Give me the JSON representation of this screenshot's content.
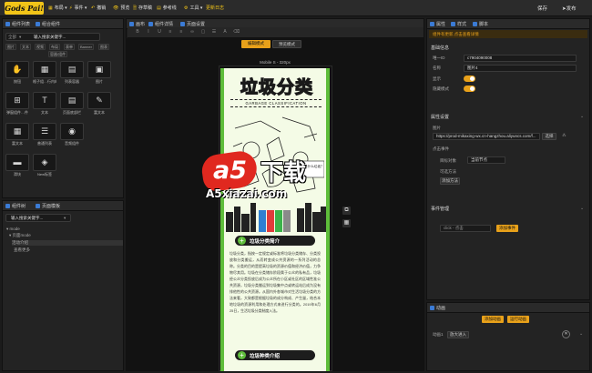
{
  "topbar": {
    "logo": "Gods Pai!",
    "menu": [
      {
        "label": "布局",
        "icon": "▦"
      },
      {
        "label": "事件",
        "icon": "⚡"
      },
      {
        "label": "撤销",
        "icon": "↶"
      },
      {
        "label": "预览",
        "icon": "👁"
      },
      {
        "label": "存草稿",
        "icon": "🗎"
      },
      {
        "label": "参考线",
        "icon": "▤"
      },
      {
        "label": "工具",
        "icon": "⚙"
      },
      {
        "label": "更新日志",
        "icon": ""
      }
    ],
    "save": "保存",
    "publish": "发布"
  },
  "left_panel": {
    "tabs": [
      "组件列表",
      "组合组件"
    ],
    "search_select": "全部",
    "search_value": "输入搜索关键字...",
    "filter_chips": [
      "图片",
      "文本",
      "视频",
      "布局",
      "表单",
      "Banner",
      "图表",
      "容器/组件"
    ],
    "components": [
      {
        "icon": "✋",
        "label": "按钮"
      },
      {
        "icon": "▦",
        "label": "格子组…行内的"
      },
      {
        "icon": "▤",
        "label": "列表容器"
      },
      {
        "icon": "▣",
        "label": "图片"
      },
      {
        "icon": "⊞",
        "label": "弹窗组件…件"
      },
      {
        "icon": "T",
        "label": "文本"
      },
      {
        "icon": "▤",
        "label": "页面底部栏"
      },
      {
        "icon": "✎",
        "label": "富文本"
      },
      {
        "icon": "▦",
        "label": "富文本"
      },
      {
        "icon": "☰",
        "label": "普通列表"
      },
      {
        "icon": "◉",
        "label": "音频组件"
      },
      {
        "icon": "▬",
        "label": "滑块"
      },
      {
        "icon": "◈",
        "label": "New标签"
      }
    ]
  },
  "left_panel2": {
    "tabs": [
      "组件树",
      "页面模板"
    ],
    "search_value": "输入搜索关键字...",
    "tree": [
      "mode",
      "页面mode",
      "活动介绍",
      "查看更多"
    ]
  },
  "center": {
    "tabs": [
      "画布",
      "组件详情",
      "页面设置"
    ],
    "mode_edit": "编辑模式",
    "mode_preview": "预览模式",
    "device_label": "Mobile S - 320px",
    "phone": {
      "title": "垃圾分类",
      "subtitle": "GARBAGE CLASSIFICATION",
      "bubble": "你是什么垃圾？",
      "section1": "垃圾分类简介",
      "body": "垃圾分类，指按一定规定或标准将垃圾分类储存、分类投放和分类搬运，从而转变成公共资源的一系列活动的总称。分类的目的是提高垃圾的资源价值和经济价值，力争物尽其用。垃圾在分类储存阶段属于公众的私有品，垃圾经公众分类投放后成为公众所在小区或社区的区域性准公共资源，垃圾分类搬运到垃圾集中点或转运站后成为没有排他性的公共资源。从国内外各城市对生活垃圾分类的方法来看，大致都是根据垃圾的成分构成、产生量，结合本地垃圾的资源利用和处理方式来进行分类的。2019年6月25日，生活垃圾分类制度入法。",
      "section2": "垃圾种类介绍"
    }
  },
  "right_panel": {
    "tabs": [
      "属性",
      "样式",
      "脚本"
    ],
    "notice": "组件有更新,点击查看详情",
    "basic_title": "基础信息",
    "fields": [
      {
        "label": "唯一ID",
        "value": "c7904090008"
      },
      {
        "label": "名称",
        "value": "图片4"
      }
    ],
    "toggles": [
      "显示",
      "隐藏模式"
    ],
    "attr_title": "属性设置",
    "image_label": "图片",
    "image_url": "https://prod-mikaxing-wx.cn-hangzhou.aliyuncs.com/f...",
    "upload": "选择",
    "click_title": "点击事件",
    "action_label": "目标对象",
    "action_value": "当前节点",
    "choose_label": "可选方法",
    "choose_btn": "添加方法",
    "event_title": "事件管理",
    "event_select": "click - 点击",
    "event_add": "添加事件",
    "anim_tab": "动画",
    "anim_add": "添加动画",
    "anim_run": "运行动画",
    "anim_label": "动画1",
    "anim_value": "放大进入"
  },
  "watermark": {
    "big": "下载",
    "small": "A5xiazai.com",
    "logo": "a5"
  }
}
